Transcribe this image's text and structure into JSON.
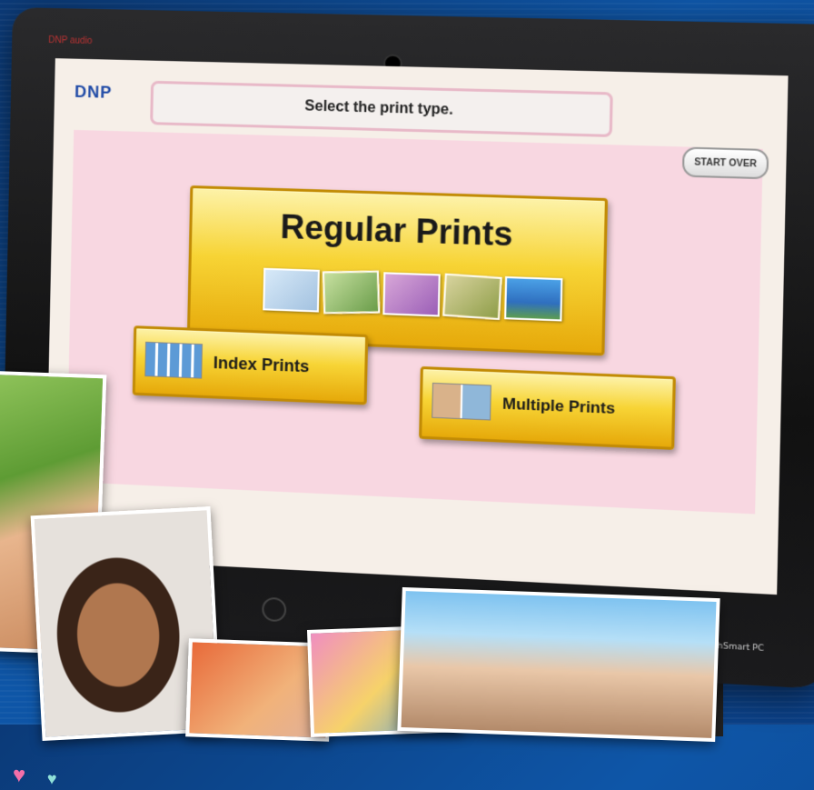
{
  "monitor": {
    "bezel_brand": "DNP audio",
    "model_label": "HP TouchSmart PC"
  },
  "header": {
    "logo": "DNP",
    "prompt": "Select the print type.",
    "start_over_label": "START OVER"
  },
  "options": {
    "regular_label": "Regular Prints",
    "index_label": "Index Prints",
    "multiple_label": "Multiple Prints"
  },
  "colors": {
    "panel_pink": "#f8d7e1",
    "button_gold": "#f7d435",
    "logo_blue": "#1f4aa6"
  }
}
